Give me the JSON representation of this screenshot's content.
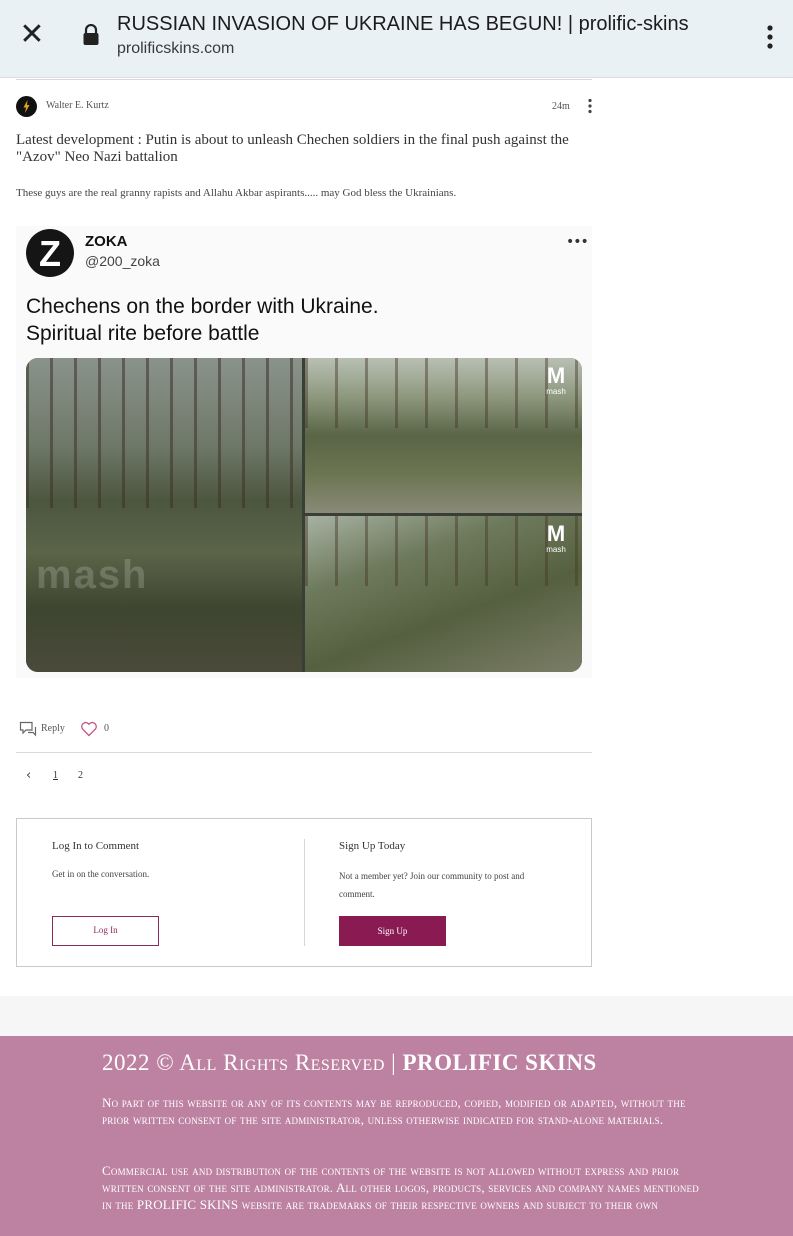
{
  "browser": {
    "page_title": "RUSSIAN INVASION OF UKRAINE HAS BEGUN! | prolific-skins",
    "url": "prolificskins.com",
    "close_icon": "close-icon",
    "lock_icon": "lock-icon",
    "menu_icon": "kebab-menu-icon"
  },
  "post": {
    "author": "Walter E. Kurtz",
    "time": "24m",
    "title": "Latest development : Putin is about to unleash Chechen soldiers in the final push against the \"Azov\" Neo Nazi battalion",
    "body": "These guys are the real granny rapists and Allahu Akbar aspirants..... may God bless the Ukrainians.",
    "embed": {
      "avatar_letter": "Z",
      "name": "ZOKA",
      "handle": "@200_zoka",
      "more": "•••",
      "text_line1": "Chechens on the border with Ukraine.",
      "text_line2": "Spiritual rite before battle",
      "logo_letter": "M",
      "logo_text": "mash",
      "watermark": "mash"
    },
    "actions": {
      "reply_label": "Reply",
      "like_count": "0"
    }
  },
  "pagination": {
    "prev": "‹",
    "pages": [
      "1",
      "2"
    ]
  },
  "login_box": {
    "login_title": "Log In to Comment",
    "login_sub": "Get in on the conversation.",
    "login_button": "Log In",
    "signup_title": "Sign Up Today",
    "signup_sub": "Not a member yet? Join our community to post and comment.",
    "signup_button": "Sign Up"
  },
  "footer": {
    "title_prefix": "2022 © All Rights Reserved | ",
    "brand": "PROLIFIC SKINS",
    "para1": "No part of this website or any of its contents may be reproduced, copied, modified or adapted, without the prior written consent of the site administrator, unless otherwise indicated for stand-alone materials.",
    "para2": "Commercial use and distribution of the contents of the website is not allowed without express and prior written consent of the site administrator. All other logos, products, services and company names mentioned in the PROLIFIC SKINS website are trademarks of their respective owners and subject to their own"
  },
  "colors": {
    "brand": "#8a1b52",
    "footer_bg": "#bd82a2",
    "browser_bar": "#e9f1f4"
  }
}
